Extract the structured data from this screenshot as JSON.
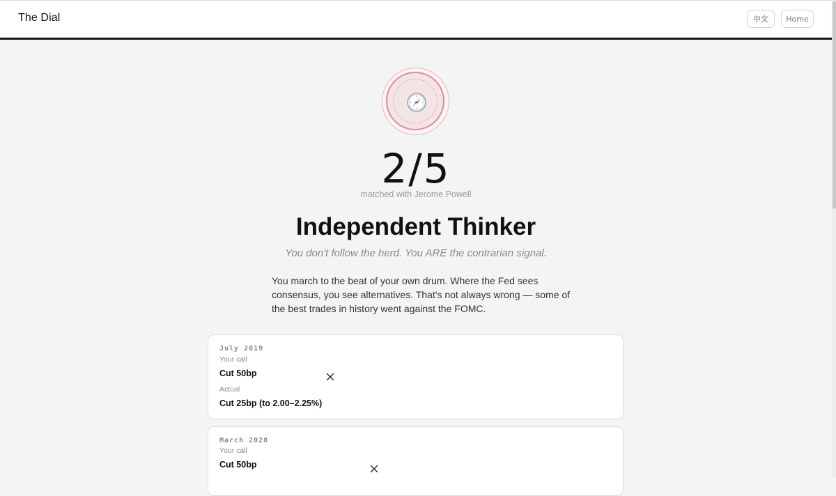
{
  "header": {
    "brand": "The Dial",
    "lang_label": "中文",
    "home_label": "Home"
  },
  "result": {
    "badge_icon": "compass-icon",
    "score": "2/5",
    "matched_text": "matched with Jerome Powell",
    "title": "Independent Thinker",
    "tagline": "You don't follow the herd. You ARE the contrarian signal.",
    "description": "You march to the beat of your own drum. Where the Fed sees consensus, you see alternatives. That's not always wrong — some of the best trades in history went against the FOMC."
  },
  "decisions": [
    {
      "date": "July 2019",
      "your_call_label": "Your call",
      "your_call": "Cut 50bp",
      "actual_label": "Actual",
      "actual": "Cut 25bp (to 2.00–2.25%)",
      "status_icon": "x-mark-icon"
    },
    {
      "date": "March 2020",
      "your_call_label": "Your call",
      "your_call": "Cut 50bp",
      "status_icon": "x-mark-icon"
    }
  ],
  "colors": {
    "accent_ring": "#d98f98",
    "badge_fill": "#f3e4e6",
    "background": "#f4f4f4"
  }
}
